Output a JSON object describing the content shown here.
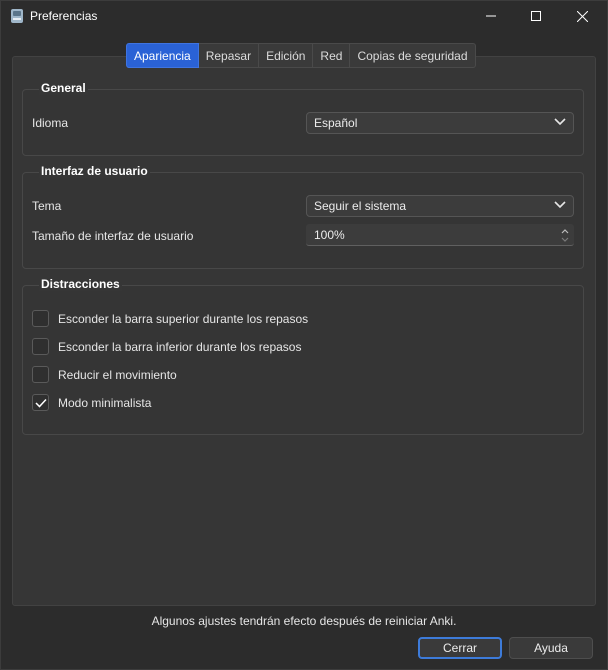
{
  "window": {
    "title": "Preferencias"
  },
  "tabs": [
    {
      "label": "Apariencia",
      "active": true
    },
    {
      "label": "Repasar",
      "active": false
    },
    {
      "label": "Edición",
      "active": false
    },
    {
      "label": "Red",
      "active": false
    },
    {
      "label": "Copias de seguridad",
      "active": false
    }
  ],
  "general": {
    "title": "General",
    "language_label": "Idioma",
    "language_value": "Español"
  },
  "ui": {
    "title": "Interfaz de usuario",
    "theme_label": "Tema",
    "theme_value": "Seguir el sistema",
    "size_label": "Tamaño de interfaz de usuario",
    "size_value": "100%"
  },
  "distractions": {
    "title": "Distracciones",
    "items": [
      {
        "label": "Esconder la barra superior durante los repasos",
        "checked": false
      },
      {
        "label": "Esconder la barra inferior durante los repasos",
        "checked": false
      },
      {
        "label": "Reducir el movimiento",
        "checked": false
      },
      {
        "label": "Modo minimalista",
        "checked": true
      }
    ]
  },
  "footer": {
    "note": "Algunos ajustes tendrán efecto después de reiniciar Anki.",
    "close_label": "Cerrar",
    "help_label": "Ayuda"
  },
  "colors": {
    "accent": "#2a62d6",
    "focus_ring": "#3d7bd9",
    "background": "#2c2c2c"
  }
}
